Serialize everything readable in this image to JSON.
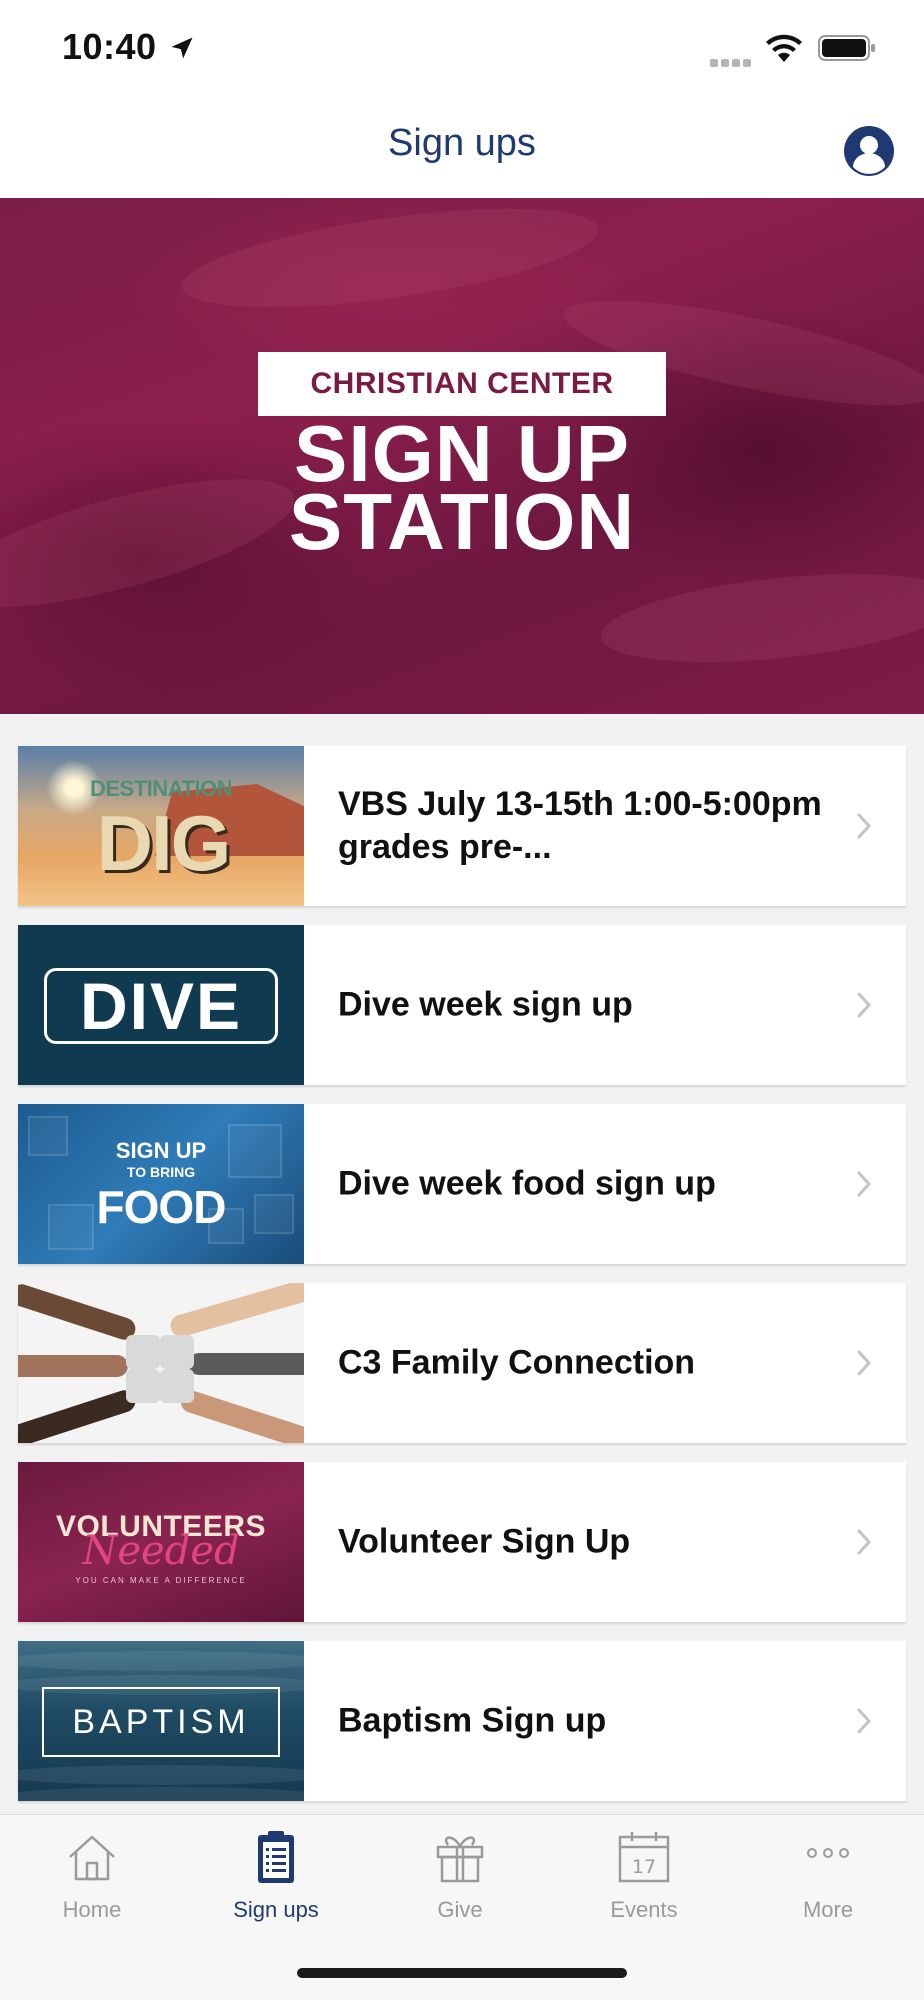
{
  "status_bar": {
    "time": "10:40"
  },
  "nav": {
    "title": "Sign ups"
  },
  "hero": {
    "label": "CHRISTIAN CENTER",
    "line1": "SIGN UP",
    "line2": "STATION",
    "color": "#7a1e45"
  },
  "signups": [
    {
      "title": "VBS July 13-15th 1:00-5:00pm grades pre-...",
      "thumb_text_top": "DESTINATION",
      "thumb_text_main": "DIG"
    },
    {
      "title": "Dive week sign up",
      "thumb_text_main": "DIVE"
    },
    {
      "title": "Dive week food sign up",
      "thumb_text_top": "SIGN UP",
      "thumb_text_mid": "TO BRING",
      "thumb_text_main": "FOOD"
    },
    {
      "title": "C3 Family Connection"
    },
    {
      "title": "Volunteer Sign Up",
      "thumb_text_top": "VOLUNTEERS",
      "thumb_text_main": "Needed",
      "thumb_text_sub": "YOU CAN MAKE A DIFFERENCE"
    },
    {
      "title": "Baptism Sign up",
      "thumb_text_main": "BAPTISM"
    }
  ],
  "tabs": [
    {
      "label": "Home",
      "icon": "home-icon",
      "active": false
    },
    {
      "label": "Sign ups",
      "icon": "clipboard-icon",
      "active": true
    },
    {
      "label": "Give",
      "icon": "gift-icon",
      "active": false
    },
    {
      "label": "Events",
      "icon": "calendar-icon",
      "active": false,
      "calendar_day": "17"
    },
    {
      "label": "More",
      "icon": "more-icon",
      "active": false
    }
  ],
  "colors": {
    "brand_navy": "#1f3a73",
    "tab_inactive": "#9a9a9a"
  }
}
